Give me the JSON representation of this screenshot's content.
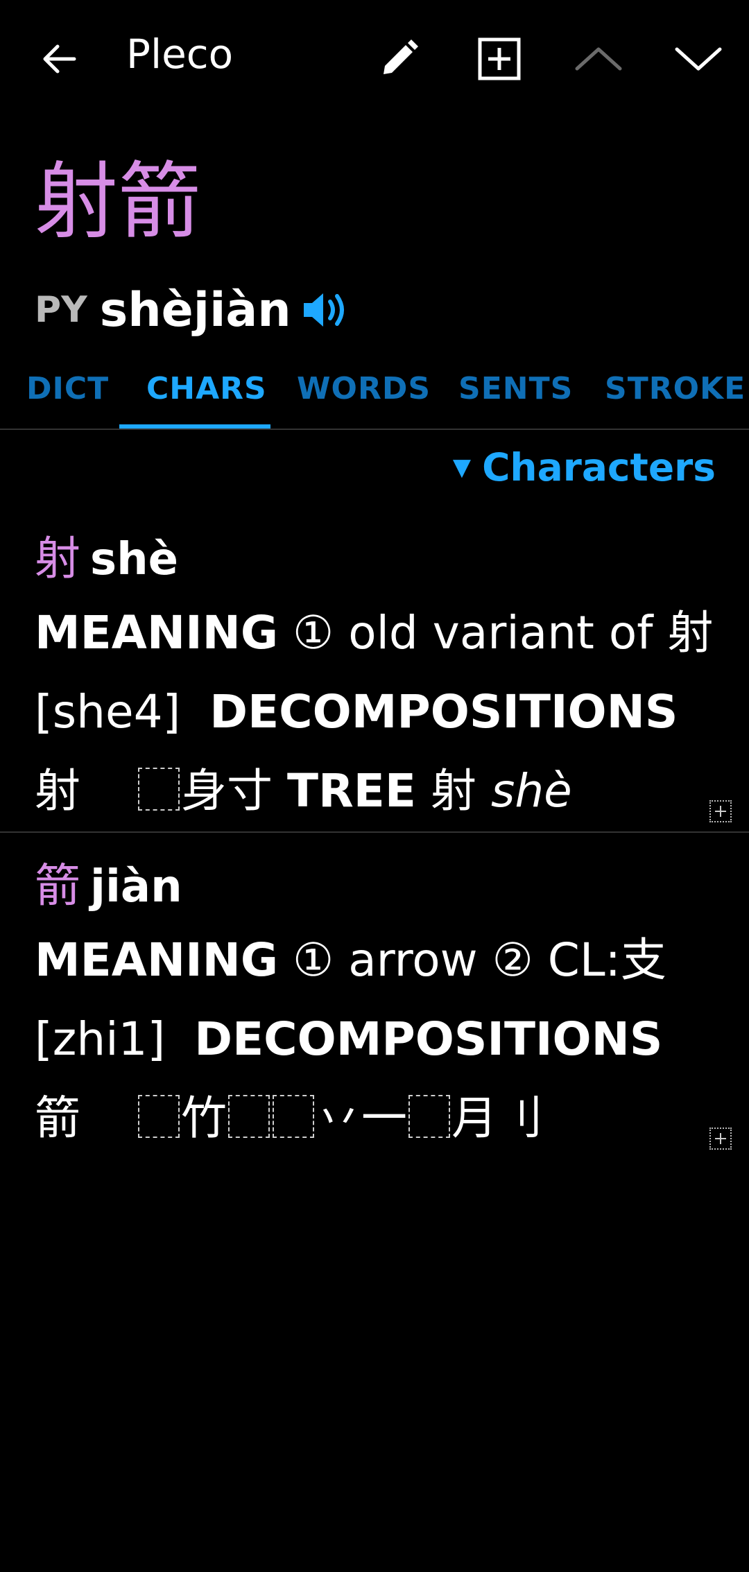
{
  "topbar": {
    "back_icon": "arrow-left-icon",
    "title": "Pleco",
    "edit_icon": "pencil-icon",
    "add_icon": "plus-square-icon",
    "prev_icon": "chevron-up-icon",
    "next_icon": "chevron-down-icon"
  },
  "headword": {
    "hanzi": "射箭",
    "py_label": "PY",
    "pinyin": "shèjiàn",
    "audio_icon": "speaker-icon"
  },
  "tabs": [
    "DICT",
    "CHARS",
    "WORDS",
    "SENTS",
    "STROKE"
  ],
  "active_tab": "CHARS",
  "section": {
    "toggle_label": "Characters"
  },
  "entries": [
    {
      "hanzi": "射",
      "pinyin": "shè",
      "meaning_label": "MEANING",
      "meaning_num": "①",
      "meaning_text": "old variant of 射",
      "meaning_ref": "[she4]",
      "decomp_label": "DECOMPOSITIONS",
      "decomp_char": "射",
      "decomp_parts": "身寸",
      "tree_label": "TREE",
      "tree_char": "射",
      "tree_py": "shè"
    },
    {
      "hanzi": "箭",
      "pinyin": "jiàn",
      "meaning_label": "MEANING",
      "meaning_num1": "①",
      "meaning_text1": "arrow",
      "meaning_num2": "②",
      "meaning_text2": "CL:支",
      "meaning_ref": "[zhi1]",
      "decomp_label": "DECOMPOSITIONS",
      "decomp_char": "箭",
      "decomp_part1": "竹",
      "decomp_part2": "丷一",
      "decomp_part3": "月刂"
    }
  ],
  "colors": {
    "accent": "#1ea8ff",
    "tab_inactive": "#0f6fb6",
    "hanzi": "#d78de6",
    "background": "#000000"
  }
}
